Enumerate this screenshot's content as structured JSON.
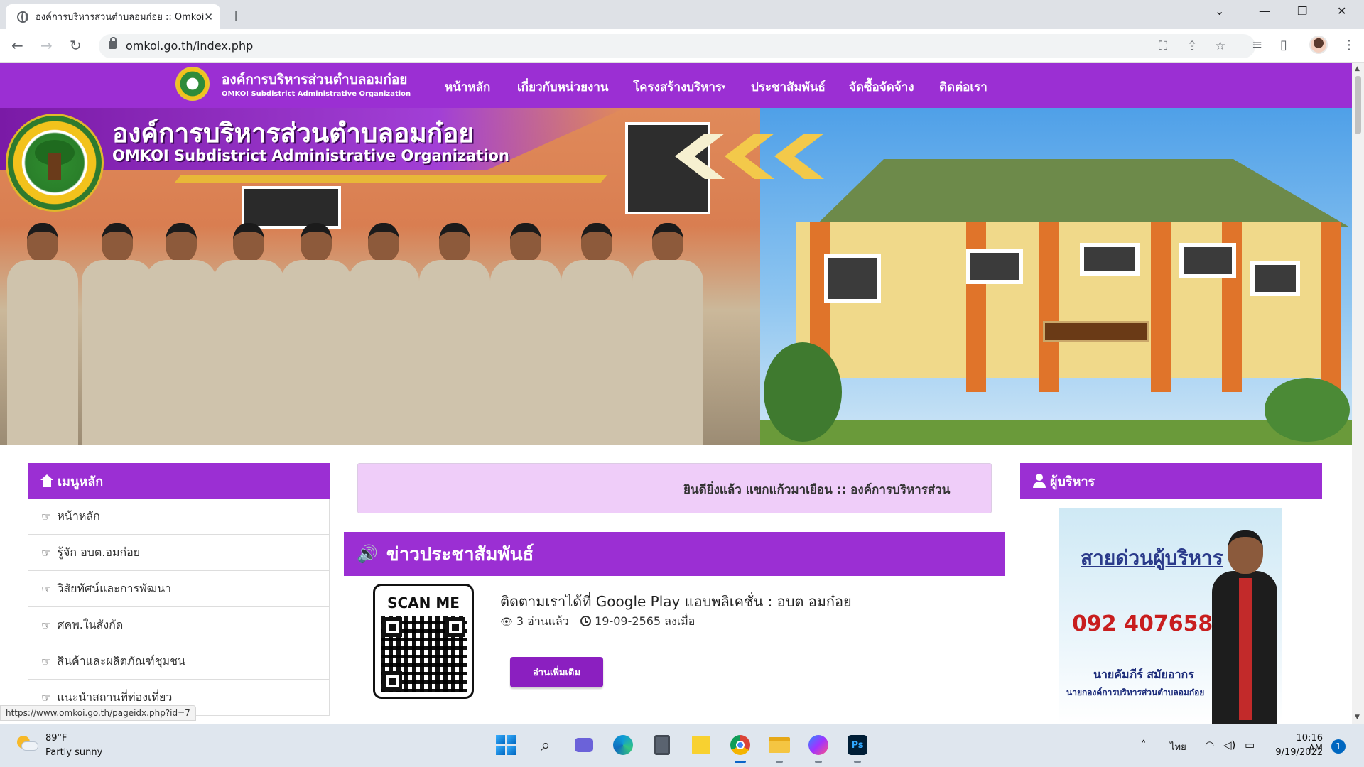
{
  "browser": {
    "tab_title": "องค์การบริหารส่วนตำบลอมก๋อย :: Omkoi",
    "tab_close": "✕",
    "new_tab": "+",
    "url": "omkoi.go.th/index.php",
    "status_url": "https://www.omkoi.go.th/pageidx.php?id=7"
  },
  "navbar": {
    "brand_th": "องค์การบริหารส่วนตำบลอมก๋อย",
    "brand_en": "OMKOI Subdistrict Administrative Organization",
    "items": [
      {
        "label": "หน้าหลัก"
      },
      {
        "label": "เกี่ยวกับหน่วยงาน"
      },
      {
        "label": "โครงสร้างบริหาร",
        "has_dropdown": true
      },
      {
        "label": "ประชาสัมพันธ์"
      },
      {
        "label": "จัดซื้อจัดจ้าง"
      },
      {
        "label": "ติดต่อเรา"
      }
    ],
    "color": "#9b2fd3"
  },
  "banner": {
    "title_th": "องค์การบริหารส่วนตำบลอมก๋อย",
    "title_en": "OMKOI Subdistrict Administrative Organization"
  },
  "sidebar": {
    "heading": "เมนูหลัก",
    "items": [
      {
        "label": "หน้าหลัก"
      },
      {
        "label": "รู้จัก อบต.อมก๋อย"
      },
      {
        "label": "วิสัยทัศน์และการพัฒนา"
      },
      {
        "label": "ศคพ.ในสังกัด"
      },
      {
        "label": "สินค้าและผลิตภัณฑ์ชุมชน"
      },
      {
        "label": "แนะนำสถานที่ท่องเที่ยว"
      }
    ]
  },
  "marquee": {
    "text": "ยินดียิ่งแล้ว แขกแก้วมาเยือน :: องค์การบริหารส่วน"
  },
  "news": {
    "heading": "ข่าวประชาสัมพันธ์",
    "items": [
      {
        "qr_label": "SCAN ME",
        "title": "ติดตามเราได้ที่ Google Play แอบพลิเคชั่น : อบต อมก๋อย",
        "views": "3 อ่านแล้ว",
        "date": "19-09-2565 ลงเมื่อ",
        "read_more": "อ่านเพิ่มเติม"
      }
    ]
  },
  "executive": {
    "heading": "ผู้บริหาร",
    "hotline_title": "สายด่วนผู้บริหาร",
    "phone": "092 4076588",
    "name": "นายคัมภีร์ สมัยอากร",
    "position": "นายกองค์การบริหารส่วนตำบลอมก๋อย"
  },
  "taskbar": {
    "temperature": "89°F",
    "weather": "Partly sunny",
    "language": "ไทย",
    "time": "10:16 AM",
    "date": "9/19/2022",
    "notifications": "1"
  }
}
